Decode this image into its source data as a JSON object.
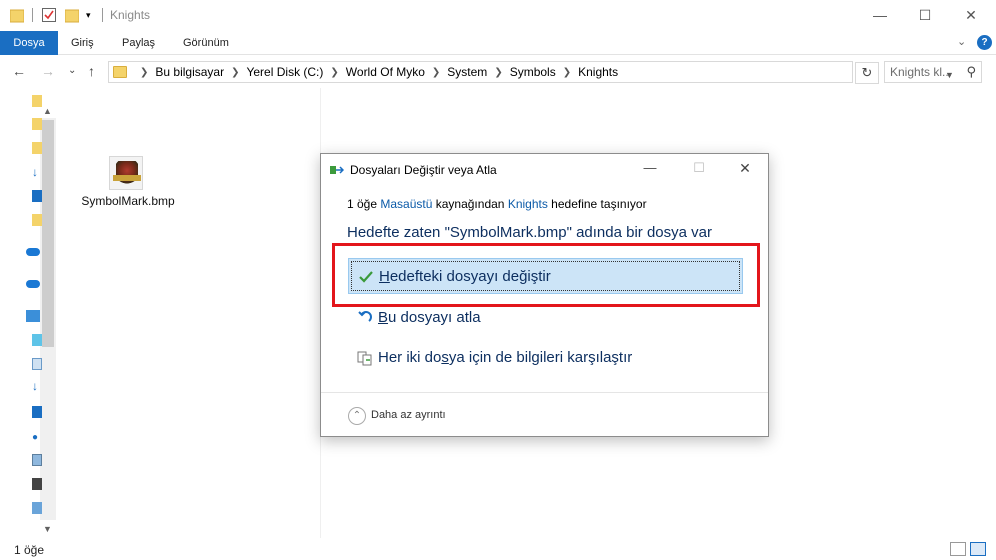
{
  "window": {
    "title": "Knights"
  },
  "ribbon": {
    "tabs": [
      {
        "label": "Dosya"
      },
      {
        "label": "Giriş"
      },
      {
        "label": "Paylaş"
      },
      {
        "label": "Görünüm"
      }
    ],
    "help_label": "?"
  },
  "address": {
    "crumbs": [
      "Bu bilgisayar",
      "Yerel Disk (C:)",
      "World Of Myko",
      "System",
      "Symbols",
      "Knights"
    ]
  },
  "search": {
    "placeholder": "Knights kl..."
  },
  "file": {
    "name": "SymbolMark.bmp"
  },
  "statusbar": {
    "count": "1 öğe"
  },
  "dialog": {
    "title": "Dosyaları Değiştir veya Atla",
    "subtitle": {
      "prefix": "1 öğe ",
      "source": "Masaüstü",
      "middle": " kaynağından ",
      "target": "Knights",
      "suffix": " hedefine taşınıyor"
    },
    "heading": "Hedefte zaten \"SymbolMark.bmp\" adında bir dosya var",
    "options": [
      {
        "access_key": "H",
        "label_rest": "edefteki dosyayı değiştir",
        "icon": "check-icon",
        "selected": true
      },
      {
        "access_key": "B",
        "label_rest": "u dosyayı atla",
        "icon": "skip-icon",
        "selected": false
      },
      {
        "label_pre": "Her iki do",
        "access_key": "s",
        "label_rest": "ya için de bilgileri karşılaştır",
        "icon": "compare-icon",
        "selected": false
      }
    ],
    "footer": {
      "label": "Daha az ayrıntı"
    }
  },
  "colors": {
    "accent": "#1a6ec2",
    "selection": "#cce4f7",
    "highlight": "#e3161b",
    "link": "#0b5aa8"
  }
}
